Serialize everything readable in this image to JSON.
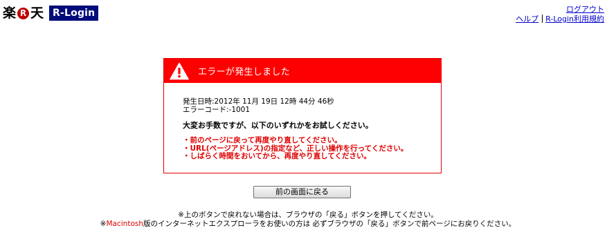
{
  "header": {
    "logo": {
      "text_before": "楽",
      "circle_letter": "R",
      "text_after": "天",
      "product": "R-Login"
    },
    "links": {
      "logout": "ログアウト",
      "help": "ヘルプ",
      "terms": "R-Login利用規約"
    }
  },
  "error": {
    "title": "エラーが発生しました",
    "occurred_at": "発生日時:2012年 11月 19日 12時 44分 46秒",
    "error_code": "エラーコード:-1001",
    "apology": "大変お手数ですが、以下のいずれかをお試しください。",
    "suggestions": [
      "・前のページに戻って再度やり直してください。",
      "・URL(ページアドレス)の指定など、正しい操作を行ってください。",
      "・しばらく時間をおいてから、再度やり直してください。"
    ]
  },
  "back_button": "前の画面に戻る",
  "notes": {
    "line1": "※上のボタンで戻れない場合は、ブラウザの「戻る」ボタンを押してください。",
    "line2_prefix": "※",
    "line2_highlight": "Macintosh",
    "line2_suffix": "版のインターネットエクスプローラをお使いの方は 必ずブラウザの「戻る」ボタンで前ページにお戻りください。"
  },
  "colors": {
    "brand_red": "#bf0000",
    "error_red": "#ff0000",
    "badge_navy": "#000c7a",
    "link_blue": "#0000cc"
  },
  "icons": {
    "warning": "warning-triangle-icon"
  }
}
